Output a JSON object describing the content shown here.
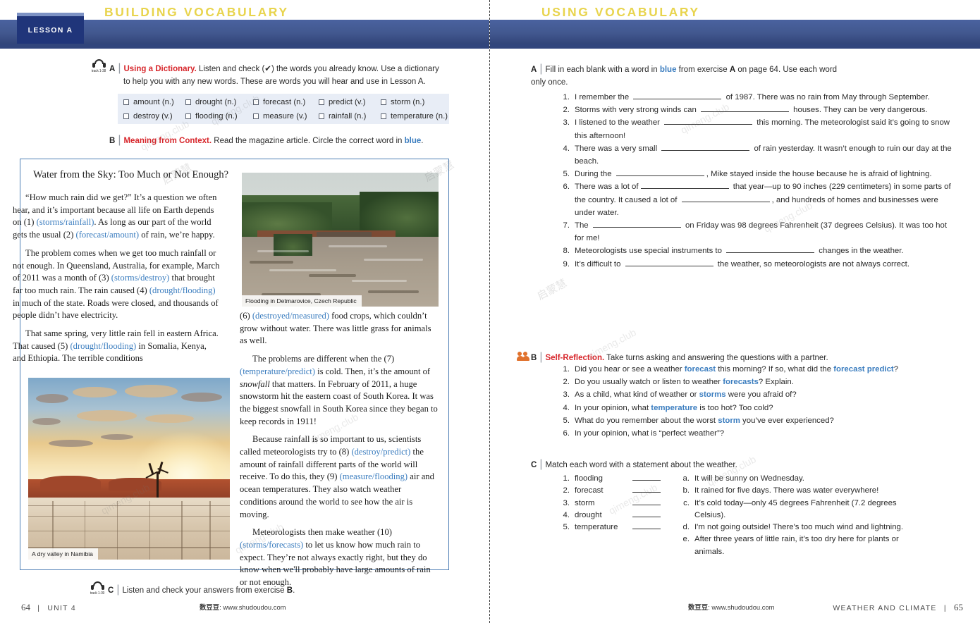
{
  "spread": {
    "left_header": {
      "lesson_tab": "LESSON A",
      "title": "BUILDING VOCABULARY"
    },
    "right_header": {
      "title": "USING VOCABULARY"
    }
  },
  "left_page": {
    "exercise_a": {
      "track": "track 1-38",
      "letter": "A",
      "bar": "|",
      "bold_title": "Using a Dictionary.",
      "line1": " Listen and check (✔) the words you already know. Use a dictionary",
      "line2": "to help you with any new words. These are words you will hear and use in Lesson A."
    },
    "vocab_box": {
      "columns": [
        [
          "amount (n.)",
          "destroy (v.)"
        ],
        [
          "drought (n.)",
          "flooding (n.)"
        ],
        [
          "forecast (n.)",
          "measure (v.)"
        ],
        [
          "predict (v.)",
          "rainfall (n.)"
        ],
        [
          "storm (n.)",
          "temperature (n.)"
        ]
      ]
    },
    "exercise_b": {
      "letter": "B",
      "bar": "|",
      "bold_title": "Meaning from Context.",
      "text_before": " Read the magazine article. Circle the correct word in ",
      "blue_word": "blue",
      "text_after": "."
    },
    "article": {
      "title": "Water from the Sky: Too Much or Not Enough?",
      "left_column": [
        {
          "parts": [
            {
              "t": "“How much rain did we get?” It’s a question we often hear, and it’s important because all life on Earth depends on (1) ",
              "c": "k"
            },
            {
              "t": "(storms/rainfall)",
              "c": "b"
            },
            {
              "t": ". As long as our part of the world gets the usual (2) ",
              "c": "k"
            },
            {
              "t": "(forecast/amount)",
              "c": "b"
            },
            {
              "t": " of rain, we’re happy.",
              "c": "k"
            }
          ]
        },
        {
          "parts": [
            {
              "t": "The problem comes when we get too much rainfall or not enough. In Queensland, Australia, for example, March of 2011 was a month of (3) ",
              "c": "k"
            },
            {
              "t": "(storms/destroy)",
              "c": "b"
            },
            {
              "t": " that brought far too much rain. The rain caused (4) ",
              "c": "k"
            },
            {
              "t": "(drought/flooding)",
              "c": "b"
            },
            {
              "t": " in much of the state. Roads were closed, and thousands of people didn’t have electricity.",
              "c": "k"
            }
          ]
        },
        {
          "parts": [
            {
              "t": "That same spring, very little rain fell in eastern Africa. That caused (5) ",
              "c": "k"
            },
            {
              "t": "(drought/flooding)",
              "c": "b"
            },
            {
              "t": " in Somalia, Kenya, and Ethiopia. The terrible conditions",
              "c": "k"
            }
          ]
        }
      ],
      "right_column": [
        {
          "indent": false,
          "parts": [
            {
              "t": "(6) ",
              "c": "k"
            },
            {
              "t": "(destroyed/measured)",
              "c": "b"
            },
            {
              "t": " food crops, which couldn’t grow without water. There was little grass for animals as well.",
              "c": "k"
            }
          ]
        },
        {
          "indent": true,
          "parts": [
            {
              "t": "The problems are different when the (7) ",
              "c": "k"
            },
            {
              "t": "(temperature/predict)",
              "c": "b"
            },
            {
              "t": " is cold. Then, it’s the amount of ",
              "c": "k"
            },
            {
              "t": "snowfall",
              "c": "i"
            },
            {
              "t": " that matters. In February of 2011, a huge snowstorm hit the eastern coast of South Korea. It was the biggest snowfall in South Korea since they began to keep records in 1911!",
              "c": "k"
            }
          ]
        },
        {
          "indent": true,
          "parts": [
            {
              "t": "Because rainfall is so important to us, scientists called meteorologists try to (8) ",
              "c": "k"
            },
            {
              "t": "(destroy/predict)",
              "c": "b"
            },
            {
              "t": " the amount of rainfall different parts of the world will receive. To do this, they (9) ",
              "c": "k"
            },
            {
              "t": "(measure/flooding)",
              "c": "b"
            },
            {
              "t": " air and ocean temperatures. They also watch weather conditions around the world to see how the air is moving.",
              "c": "k"
            }
          ]
        },
        {
          "indent": true,
          "parts": [
            {
              "t": "Meteorologists then make weather (10) ",
              "c": "k"
            },
            {
              "t": "(storms/forecasts)",
              "c": "b"
            },
            {
              "t": " to let us know how much rain to expect. They’re not always exactly right, but they do know when we'll probably have large amounts of rain or not enough.",
              "c": "k"
            }
          ]
        }
      ]
    },
    "photos": {
      "flood_caption": "Flooding in Detmarovice, Czech Republic",
      "desert_caption": "A dry valley in Namibia"
    },
    "exercise_c": {
      "track": "track 1-39",
      "letter": "C",
      "bar": "|",
      "text_before": "Listen and check your answers from exercise ",
      "bold_ref": "B",
      "text_after": "."
    },
    "footer": {
      "page_number": "64",
      "separator": "|",
      "unit": "UNIT 4",
      "site_cn": "数豆豆",
      "site_url": ": www.shudoudou.com"
    }
  },
  "right_page": {
    "exercise_a": {
      "letter": "A",
      "bar": "|",
      "intro_1": "Fill in each blank with a word in ",
      "intro_blue": "blue",
      "intro_2": " from exercise ",
      "intro_bold": "A",
      "intro_3": " on page 64. Use each word",
      "intro_4": "only once.",
      "items": [
        {
          "n": "1.",
          "segments": [
            {
              "t": "I remember the "
            },
            {
              "blank": 125
            },
            {
              "t": " of 1987. There was no rain from May through September."
            }
          ]
        },
        {
          "n": "2.",
          "segments": [
            {
              "t": "Storms with very strong winds can "
            },
            {
              "blank": 125
            },
            {
              "t": " houses. They can be very dangerous."
            }
          ]
        },
        {
          "n": "3.",
          "segments": [
            {
              "t": "I listened to the weather "
            },
            {
              "blank": 125
            },
            {
              "t": " this morning. The meteorologist said it’s going to snow this afternoon!"
            }
          ]
        },
        {
          "n": "4.",
          "segments": [
            {
              "t": "There was a very small "
            },
            {
              "blank": 125
            },
            {
              "t": " of rain yesterday. It wasn’t enough to ruin our day at the beach."
            }
          ]
        },
        {
          "n": "5.",
          "segments": [
            {
              "t": "During the "
            },
            {
              "blank": 125
            },
            {
              "t": ", Mike stayed inside the house because he is afraid of lightning."
            }
          ]
        },
        {
          "n": "6.",
          "segments": [
            {
              "t": "There was a lot of"
            },
            {
              "blank": 125
            },
            {
              "t": " that year—up to 90 inches (229 centimeters) in some parts of the country. It caused a lot of "
            },
            {
              "blank": 125
            },
            {
              "t": ", and hundreds of homes and businesses were under water."
            }
          ]
        },
        {
          "n": "7.",
          "segments": [
            {
              "t": "The "
            },
            {
              "blank": 125
            },
            {
              "t": " on Friday was 98 degrees Fahrenheit (37 degrees Celsius). It was too hot for me!"
            }
          ]
        },
        {
          "n": "8.",
          "segments": [
            {
              "t": "Meteorologists use special instruments to "
            },
            {
              "blank": 125
            },
            {
              "t": " changes in the weather."
            }
          ]
        },
        {
          "n": "9.",
          "segments": [
            {
              "t": "It’s difficult to "
            },
            {
              "blank": 125
            },
            {
              "t": " the weather, so meteorologists are not always correct."
            }
          ]
        }
      ]
    },
    "exercise_b": {
      "letter": "B",
      "bar": "|",
      "bold_title": "Self-Reflection.",
      "text": " Take turns asking and answering the questions with a partner.",
      "items": [
        {
          "n": "1.",
          "parts": [
            {
              "t": "Did you hear or see a weather ",
              "c": "k"
            },
            {
              "t": "forecast",
              "c": "b"
            },
            {
              "t": " this morning? If so, what did the ",
              "c": "k"
            },
            {
              "t": "forecast predict",
              "c": "b"
            },
            {
              "t": "?",
              "c": "k"
            }
          ]
        },
        {
          "n": "2.",
          "parts": [
            {
              "t": "Do you usually watch or listen to weather ",
              "c": "k"
            },
            {
              "t": "forecasts",
              "c": "b"
            },
            {
              "t": "? Explain.",
              "c": "k"
            }
          ]
        },
        {
          "n": "3.",
          "parts": [
            {
              "t": "As a child, what kind of weather or ",
              "c": "k"
            },
            {
              "t": "storms",
              "c": "b"
            },
            {
              "t": " were you afraid of?",
              "c": "k"
            }
          ]
        },
        {
          "n": "4.",
          "parts": [
            {
              "t": "In your opinion, what ",
              "c": "k"
            },
            {
              "t": "temperature",
              "c": "b"
            },
            {
              "t": " is too hot? Too cold?",
              "c": "k"
            }
          ]
        },
        {
          "n": "5.",
          "parts": [
            {
              "t": "What do you remember about the worst ",
              "c": "k"
            },
            {
              "t": "storm",
              "c": "b"
            },
            {
              "t": " you’ve ever experienced?",
              "c": "k"
            }
          ]
        },
        {
          "n": "6.",
          "parts": [
            {
              "t": "In your opinion, what is “perfect weather”?",
              "c": "k"
            }
          ]
        }
      ]
    },
    "exercise_c": {
      "letter": "C",
      "bar": "|",
      "text": "Match each word with a statement about the weather.",
      "words": [
        {
          "n": "1.",
          "w": "flooding"
        },
        {
          "n": "2.",
          "w": "forecast"
        },
        {
          "n": "3.",
          "w": "storm"
        },
        {
          "n": "4.",
          "w": "drought"
        },
        {
          "n": "5.",
          "w": "temperature"
        }
      ],
      "statements": [
        {
          "n": "a.",
          "t": "It will be sunny on Wednesday."
        },
        {
          "n": "b.",
          "t": "It rained for five days. There was water everywhere!"
        },
        {
          "n": "c.",
          "t": "It’s cold today—only 45 degrees Fahrenheit (7.2 degrees Celsius)."
        },
        {
          "n": "d.",
          "t": "I'm not going outside! There's too much wind and lightning."
        },
        {
          "n": "e.",
          "t": "After three years of little rain, it’s too dry here for plants or animals."
        }
      ]
    },
    "footer": {
      "site_cn": "数豆豆",
      "site_url": ": www.shudoudou.com",
      "unit_title": "WEATHER AND CLIMATE",
      "separator": "|",
      "page_number": "65"
    }
  },
  "watermarks": [
    "qimeng.club",
    "启蒙慧"
  ],
  "colors": {
    "header_blue": "#42588f",
    "header_underline": "#31457c",
    "tab_navy": "#20357a",
    "title_yellow": "#e8d44d",
    "accent_red": "#d7262b",
    "accent_blue": "#3b7dbf",
    "vocab_box_bg": "#e8edf6",
    "article_border": "#4f7fb5",
    "partner_orange": "#e0712c"
  }
}
